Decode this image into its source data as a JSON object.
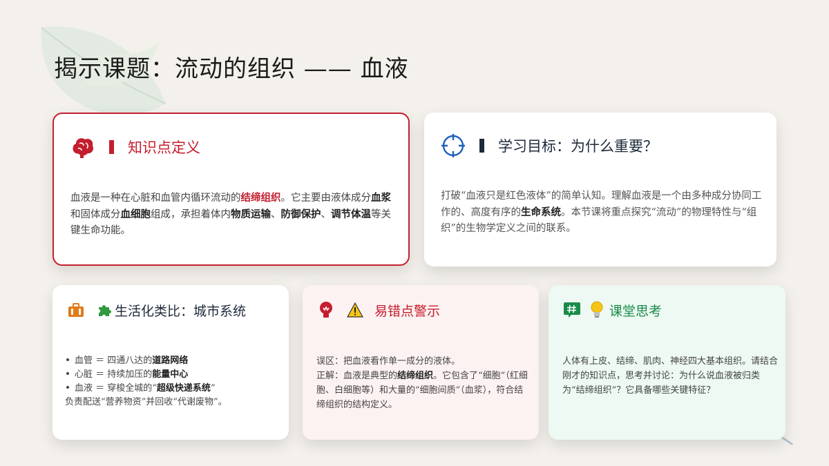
{
  "page": {
    "title": "揭示课题：流动的组织 —— 血液"
  },
  "colors": {
    "accent_red": "#c41e2e",
    "accent_blue": "#1f5fbf",
    "accent_navy": "#1d2a3a",
    "accent_orange": "#e07b1a",
    "accent_green": "#1a8a4a"
  },
  "definition": {
    "icon": "brain-icon",
    "title": "知识点定义",
    "p1": "血液是一种在心脏和血管内循环流动的",
    "h1": "结缔组织",
    "p2": "。它主要由液体成分",
    "h2": "血浆",
    "p3": "和固体成分",
    "h3": "血细胞",
    "p4": "组成，承担着体内",
    "h4": "物质运输",
    "p5": "、",
    "h5": "防御保护",
    "p6": "、",
    "h6": "调节体温",
    "p7": "等关键生命功能。"
  },
  "goal": {
    "icon": "crosshair-icon",
    "title": "学习目标：为什么重要？",
    "p1": "打破“血液只是红色液体”的简单认知。理解血液是一个由多种成分协同工作的、高度有序的",
    "h1": "生命系统",
    "p2": "。本节课将重点探究“流动”的物理特性与“组织”的生物学定义之间的联系。"
  },
  "analogy": {
    "icon": "briefcase-icon",
    "emoji_icon": "puzzle-icon",
    "title": "生活化类比：城市系统",
    "items": [
      {
        "pre": "血管 ＝ 四通八达的",
        "bold": "道路网络",
        "post": ""
      },
      {
        "pre": "心脏 ＝ 持续加压的",
        "bold": "能量中心",
        "post": ""
      },
      {
        "pre": "血液 ＝ 穿梭全城的“",
        "bold": "超级快递系统",
        "post": "”"
      }
    ],
    "tail": "负责配送“营养物资”并回收“代谢废物”。"
  },
  "warning": {
    "icon": "bulb-icon",
    "emoji_icon": "warning-icon",
    "title": "易错点警示",
    "line1": "误区：把血液看作单一成分的液体。",
    "p1": "正解：血液是典型的",
    "h1": "结缔组织",
    "p2": "。它包含了“细胞”（红细胞、白细胞等）和大量的“细胞间质”（血浆），符合结缔组织的结构定义。"
  },
  "thinking": {
    "icon": "hash-icon",
    "emoji_icon": "lightbulb-icon",
    "title": "课堂思考",
    "text": "人体有上皮、结缔、肌肉、神经四大基本组织。请结合刚才的知识点，思考并讨论：为什么说血液被归类为“结缔组织”？它具备哪些关键特征？"
  }
}
